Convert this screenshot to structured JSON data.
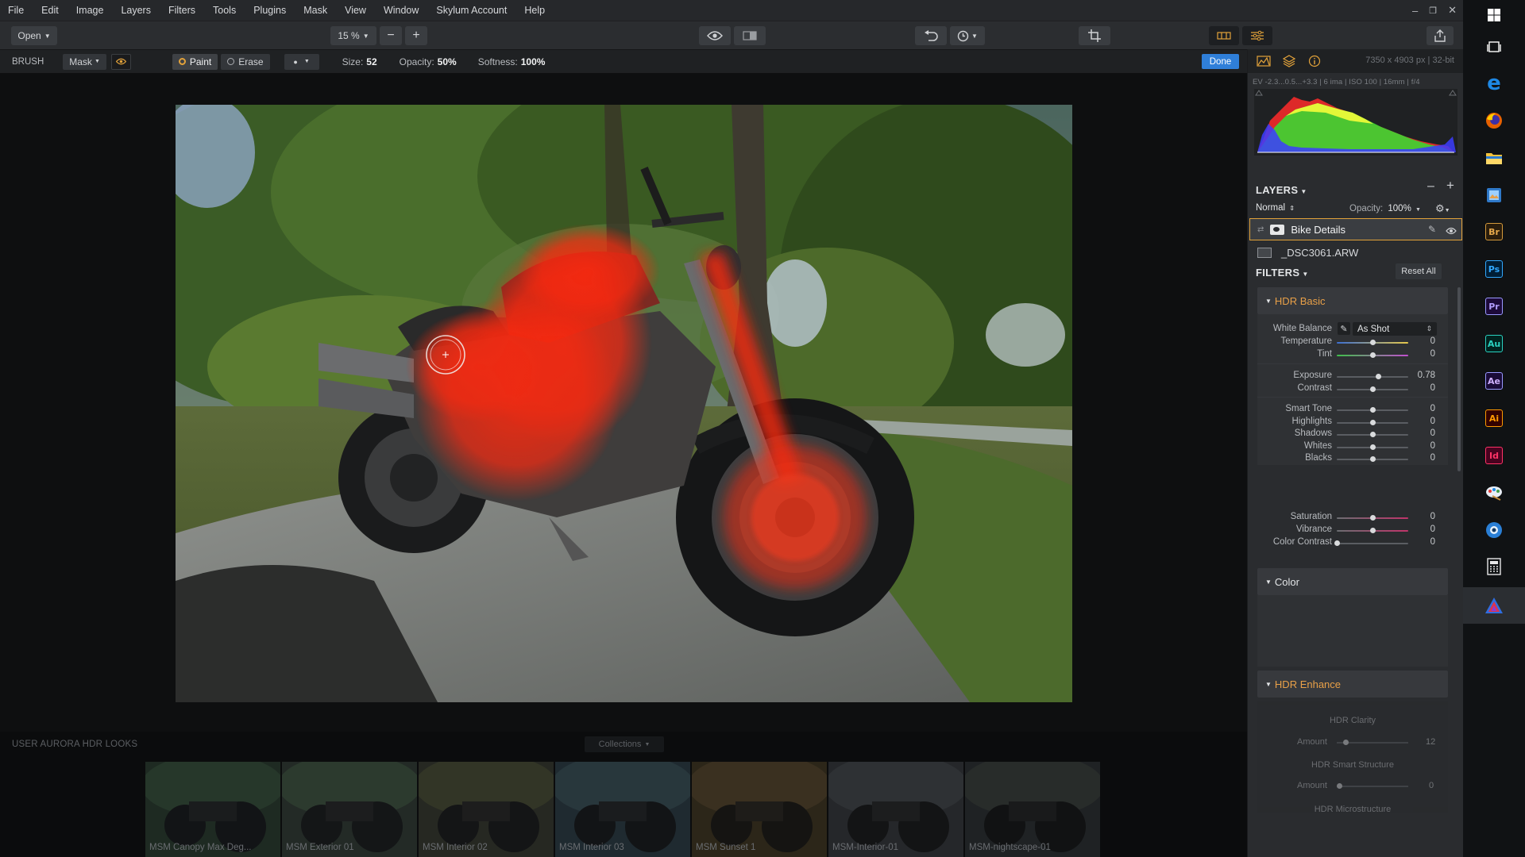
{
  "menu": [
    "File",
    "Edit",
    "Image",
    "Layers",
    "Filters",
    "Tools",
    "Plugins",
    "Mask",
    "View",
    "Window",
    "Skylum Account",
    "Help"
  ],
  "toolbar": {
    "open_label": "Open",
    "zoom": "15 %"
  },
  "brush": {
    "title": "BRUSH",
    "mask_label": "Mask",
    "paint_label": "Paint",
    "erase_label": "Erase",
    "size_label": "Size:",
    "size": "52",
    "opacity_label": "Opacity:",
    "opacity": "50%",
    "softness_label": "Softness:",
    "softness": "100%",
    "done_label": "Done"
  },
  "image_info": {
    "dims": "7350 x 4903 px",
    "depth": "32-bit",
    "exif": "EV -2.3...0.5...+3.3  |  6 ima  |  ISO 100  |  16mm  |  f/4"
  },
  "layers": {
    "title": "LAYERS",
    "blend_mode": "Normal",
    "opacity_label": "Opacity:",
    "opacity": "100%",
    "items": [
      {
        "name": "Bike Details",
        "selected": true
      },
      {
        "name": "_DSC3061.ARW",
        "selected": false
      }
    ]
  },
  "filters": {
    "title": "FILTERS",
    "reset_label": "Reset All",
    "hdr_basic": {
      "title": "HDR Basic",
      "wb_label": "White Balance",
      "wb_value": "As Shot",
      "sliders": [
        {
          "label": "Temperature",
          "value": "0",
          "pos": 0.5
        },
        {
          "label": "Tint",
          "value": "0",
          "pos": 0.5
        },
        {
          "label": "Exposure",
          "value": "0.78",
          "pos": 0.58
        },
        {
          "label": "Contrast",
          "value": "0",
          "pos": 0.5
        },
        {
          "label": "Smart Tone",
          "value": "0",
          "pos": 0.5
        },
        {
          "label": "Highlights",
          "value": "0",
          "pos": 0.5
        },
        {
          "label": "Shadows",
          "value": "0",
          "pos": 0.5
        },
        {
          "label": "Whites",
          "value": "0",
          "pos": 0.5
        },
        {
          "label": "Blacks",
          "value": "0",
          "pos": 0.5
        }
      ]
    },
    "color": {
      "title": "Color",
      "sliders": [
        {
          "label": "Saturation",
          "value": "0",
          "pos": 0.5
        },
        {
          "label": "Vibrance",
          "value": "0",
          "pos": 0.5
        },
        {
          "label": "Color Contrast",
          "value": "0",
          "pos": 0.0
        }
      ]
    },
    "hdr_enhance": {
      "title": "HDR Enhance",
      "clarity_title": "HDR Clarity",
      "clarity_amount_label": "Amount",
      "clarity_amount": "12",
      "smart_structure_title": "HDR Smart Structure",
      "smart_structure_amount_label": "Amount",
      "smart_structure_amount": "0",
      "microstructure_title": "HDR Microstructure"
    }
  },
  "looks": {
    "title": "USER AURORA HDR LOOKS",
    "collections_label": "Collections",
    "items": [
      "MSM Canopy Max Deg...",
      "MSM Exterior 01",
      "MSM Interior 02",
      "MSM Interior 03",
      "MSM Sunset 1",
      "MSM-Interior-01",
      "MSM-nightscape-01"
    ]
  },
  "colors": {
    "accent": "#2f7fd9",
    "selection": "#e2a23a",
    "mask": "#ff2a10",
    "hdr_title": "#e8a048"
  },
  "taskbar": [
    "windows-start-icon",
    "task-view-icon",
    "edge-icon",
    "firefox-icon",
    "file-explorer-icon",
    "photo-app-icon",
    "Br",
    "Ps",
    "Pr",
    "Au",
    "Ae",
    "Ai",
    "Id",
    "paint-app-icon",
    "camera-app-icon",
    "calculator-icon",
    "aurora-hdr-icon"
  ]
}
